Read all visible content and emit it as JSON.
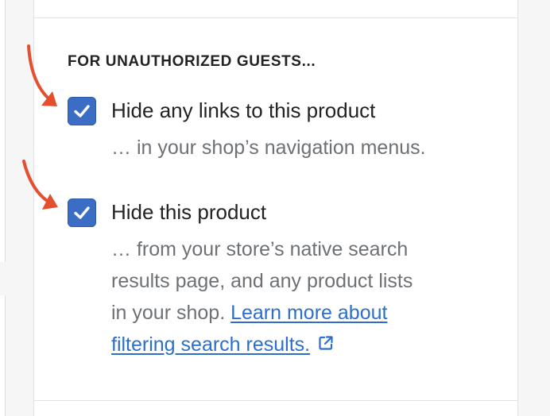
{
  "section": {
    "heading": "FOR UNAUTHORIZED GUESTS..."
  },
  "options": [
    {
      "label": "Hide any links to this product",
      "checked": true,
      "help": "… in your shop’s navigation menus."
    },
    {
      "label": "Hide this product",
      "checked": true,
      "help_line1": "… from your store’s native search",
      "help_line2": "results page, and any product lists",
      "help_line3_prefix": "in your shop. ",
      "link_text_part1": "Learn more about",
      "link_text_part2": "filtering search results."
    }
  ],
  "colors": {
    "checkbox": "#3b6dc5",
    "link": "#2c6ecb",
    "arrow": "#e4502f",
    "help_text": "#6d7175"
  },
  "icons": {
    "checkmark": "checkmark-icon",
    "external_link": "external-link-icon",
    "annotation_arrow": "arrow-icon"
  }
}
